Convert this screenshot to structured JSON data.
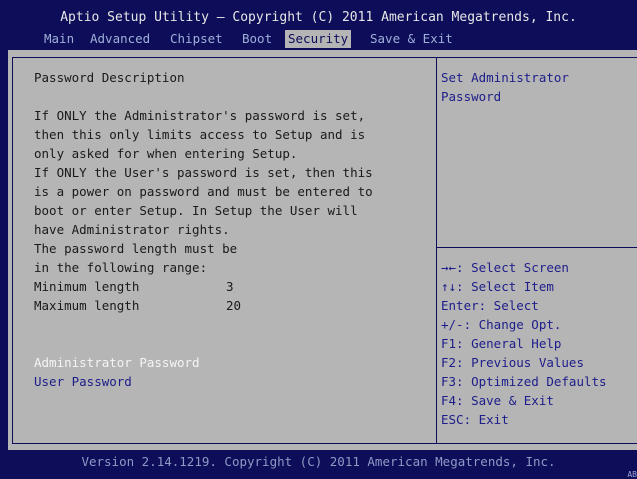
{
  "header": {
    "title": "Aptio Setup Utility – Copyright (C) 2011 American Megatrends, Inc.",
    "tabs": [
      "Main",
      "Advanced",
      "Chipset",
      "Boot",
      "Security",
      "Save & Exit"
    ],
    "active_tab": "Security"
  },
  "description": {
    "heading": "Password Description",
    "lines": [
      "If ONLY the Administrator's password is set,",
      "then this only limits access to Setup and is",
      "only asked for when entering Setup.",
      "If ONLY the User's password is set, then this",
      "is a power on password and must be entered to",
      "boot or enter Setup. In Setup the User will",
      "have Administrator rights.",
      "The password length must be",
      "in the following range:"
    ],
    "min_label": "Minimum length",
    "min_value": "3",
    "max_label": "Maximum length",
    "max_value": "20"
  },
  "items": {
    "admin_password": "Administrator Password",
    "user_password": "User Password"
  },
  "help": {
    "line1": "Set Administrator",
    "line2": "Password"
  },
  "keys": [
    "→←: Select Screen",
    "↑↓: Select Item",
    "Enter: Select",
    "+/-: Change Opt.",
    "F1: General Help",
    "F2: Previous Values",
    "F3: Optimized Defaults",
    "F4: Save & Exit",
    "ESC: Exit"
  ],
  "footer": {
    "version": "Version 2.14.1219. Copyright (C) 2011 American Megatrends, Inc.",
    "corner": "AB"
  },
  "colors": {
    "background": "#0d0d5a",
    "panel": "#b5b5b5",
    "active_tab": "#b5b5b5",
    "selected_item_text": "#f5f5f5",
    "link_text": "#1d1d8a"
  }
}
